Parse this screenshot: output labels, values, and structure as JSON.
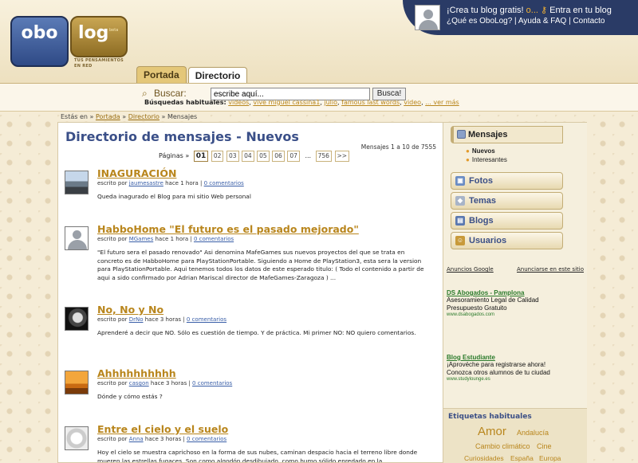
{
  "header": {
    "logo_left": "obo",
    "logo_right": "log",
    "logo_beta": "beta",
    "logo_slogan": "TUS PENSAMIENTOS EN RED",
    "top_link_crea": "¡Crea tu blog gratis!",
    "top_sep": "o...",
    "top_link_entra": "Entra en tu blog",
    "top_link_que": "¿Qué es OboLog?",
    "top_link_ayuda": "Ayuda & FAQ",
    "top_link_contacto": "Contacto",
    "tabs": [
      "Portada",
      "Directorio"
    ]
  },
  "search": {
    "label": "Buscar:",
    "value": "escribe aquí...",
    "button": "Busca!",
    "habituales_label": "Búsquedas habituales:",
    "habituales": [
      "videos",
      "vive miguel cassina1",
      "julio",
      "famous last words",
      "video",
      "... ver más"
    ]
  },
  "breadcrumb": {
    "prefix": "Estás en »",
    "items": [
      "Portada",
      "Directorio"
    ],
    "current": "Mensajes"
  },
  "main": {
    "title": "Directorio de mensajes - Nuevos",
    "count": "Mensajes 1 a 10 de 7555",
    "pages_label": "Páginas »",
    "pages": [
      "01",
      "02",
      "03",
      "04",
      "05",
      "06",
      "07",
      "...",
      "756",
      ">>"
    ],
    "posts": [
      {
        "title": "INAGURACIÓN",
        "by": "escrito por",
        "author": "jaumesastre",
        "time": "hace 1 hora",
        "comments": "0 comentarios",
        "body": "Queda inagurado el Blog para mi sitio Web personal"
      },
      {
        "title": "HabboHome \"El futuro es el pasado mejorado\"",
        "by": "escrito por",
        "author": "MGames",
        "time": "hace 1 hora",
        "comments": "0 comentarios",
        "body": "\"El futuro sera el pasado renovado\" Asi denomina MafeGames sus nuevos proyectos del que se trata en concreto es de HabboHome para PlayStationPortable. Siguiendo a Home de PlayStation3, esta sera la version para PlayStationPortable. Aqui tenemos todos los datos de este esperado titulo: ( Todo el contenido a partir de aqui a sido confirmado por Adrian Mariscal director de MafeGames-Zaragoza ) ..."
      },
      {
        "title": "No, No y No",
        "by": "escrito por",
        "author": "DrNo",
        "time": "hace 3 horas",
        "comments": "0 comentarios",
        "body": "Aprenderé a decir que NO. Sólo es cuestión de tiempo. Y de práctica. Mi primer NO: NO quiero comentarios."
      },
      {
        "title": "Ahhhhhhhhhh",
        "by": "escrito por",
        "author": "casgon",
        "time": "hace 3 horas",
        "comments": "0 comentarios",
        "body": "Dónde y cómo estás ?"
      },
      {
        "title": "Entre el cielo y el suelo",
        "by": "escrito por",
        "author": "Anna",
        "time": "hace 3 horas",
        "comments": "0 comentarios",
        "body": "Hoy el cielo se muestra caprichoso en la forma de sus nubes, caminan despacio hacia el terreno libre donde mueren las estrellas fugaces. Son como algodón desdibujado, como humo sólido enredado en la"
      }
    ]
  },
  "sidebar": {
    "mensajes": "Mensajes",
    "sub_nuevos": "Nuevos",
    "sub_interesantes": "Interesantes",
    "fotos": "Fotos",
    "temas": "Temas",
    "blogs": "Blogs",
    "usuarios": "Usuarios",
    "ads_google": "Anuncios Google",
    "ads_anunciarse": "Anunciarse en este sitio",
    "ads": [
      {
        "title": "DS Abogados - Pamplona",
        "lines": [
          "Asesoramiento Legal de Calidad",
          "Presupuesto Gratuito"
        ],
        "url": "www.dsabogados.com"
      },
      {
        "title": "Blog Estudiante",
        "lines": [
          "¡Aprovéche para registrarse ahora!",
          "Conozca otros alumnos de tu ciudad"
        ],
        "url": "www.studylounge.es"
      }
    ],
    "tags_title": "Etiquetas habituales",
    "tags": [
      "Amor",
      "Andalucía",
      "Cambio climático",
      "Cine",
      "Curiosidades",
      "España",
      "Europa"
    ]
  },
  "colors": {
    "accent_gold": "#b9861d",
    "nav_blue": "#2a3b66",
    "title_blue": "#3a4f88",
    "ad_green": "#2a7a2a"
  },
  "icons": [
    "search-icon",
    "key-icon",
    "avatar-icon",
    "folder-icon",
    "photo-icon",
    "tag-icon",
    "blog-icon",
    "users-icon"
  ]
}
